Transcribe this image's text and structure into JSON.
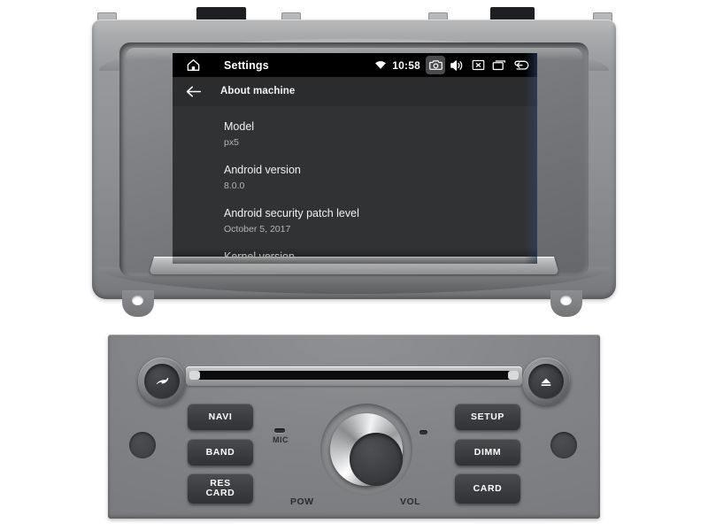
{
  "screen": {
    "statusbar": {
      "home_icon": "home-icon",
      "title": "Settings",
      "wifi_icon": "wifi-icon",
      "time": "10:58",
      "buttons": [
        {
          "name": "screenshot-camera",
          "icon": "camera-icon",
          "pressed": true
        },
        {
          "name": "volume",
          "icon": "speaker-icon",
          "pressed": false
        },
        {
          "name": "close",
          "icon": "x-box-icon",
          "pressed": false
        },
        {
          "name": "recent-apps",
          "icon": "recents-square-icon",
          "pressed": false
        },
        {
          "name": "back",
          "icon": "back-arrow-icon",
          "pressed": false
        }
      ]
    },
    "actionbar": {
      "back_icon": "arrow-left-icon",
      "title": "About machine"
    },
    "list": [
      {
        "title": "Model",
        "value": "px5"
      },
      {
        "title": "Android version",
        "value": "8.0.0"
      },
      {
        "title": "Android security patch level",
        "value": "October 5, 2017"
      },
      {
        "title": "Kernel version",
        "value": ""
      }
    ]
  },
  "panel": {
    "left_knob": {
      "label": "",
      "icon": "phone-call-icon"
    },
    "right_knob": {
      "label": "",
      "icon": "eject-icon"
    },
    "cd_slot": "disc-slot",
    "volume_knob": {
      "left_label": "POW",
      "right_label": "VOL"
    },
    "mic": {
      "label": "MIC"
    },
    "left_buttons": [
      {
        "lines": [
          "NAVI"
        ]
      },
      {
        "lines": [
          "BAND"
        ]
      },
      {
        "lines": [
          "RES",
          "CARD"
        ]
      }
    ],
    "right_buttons": [
      {
        "lines": [
          "SETUP"
        ]
      },
      {
        "lines": [
          "DIMM"
        ]
      },
      {
        "lines": [
          "CARD"
        ]
      }
    ]
  },
  "colors": {
    "bezel": "#8d8f92",
    "screen_bg": "#313234",
    "statusbar_bg": "#000000",
    "accent_text": "#f1f1f1"
  }
}
